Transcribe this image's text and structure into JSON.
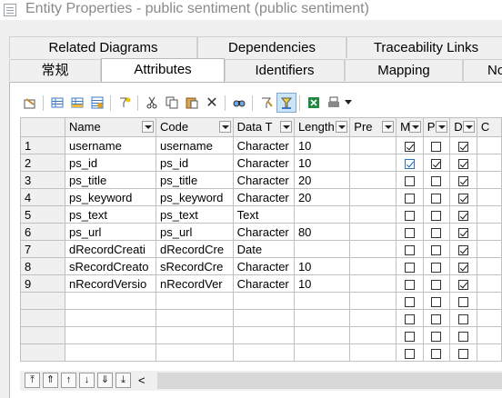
{
  "window": {
    "title": "Entity Properties - public sentiment (public sentiment)"
  },
  "tabs_row1": [
    "Related Diagrams",
    "Dependencies",
    "Traceability Links"
  ],
  "tabs_row2": [
    "常规",
    "Attributes",
    "Identifiers",
    "Mapping",
    "No"
  ],
  "active_tab": "Attributes",
  "grid": {
    "columns": [
      "Name",
      "Code",
      "Data T",
      "Length",
      "Pre",
      "M",
      "P",
      "D",
      "C"
    ],
    "rows": [
      {
        "n": "1",
        "name": "username",
        "code": "username",
        "type": "Character",
        "length": "10",
        "m": true,
        "p": false,
        "d": true
      },
      {
        "n": "2",
        "name": "ps_id",
        "code": "ps_id",
        "type": "Character",
        "length": "10",
        "m": true,
        "p": true,
        "d": true
      },
      {
        "n": "3",
        "name": "ps_title",
        "code": "ps_title",
        "type": "Character",
        "length": "20",
        "m": false,
        "p": false,
        "d": true
      },
      {
        "n": "4",
        "name": "ps_keyword",
        "code": "ps_keyword",
        "type": "Character",
        "length": "20",
        "m": false,
        "p": false,
        "d": true
      },
      {
        "n": "5",
        "name": "ps_text",
        "code": "ps_text",
        "type": "Text",
        "length": "",
        "m": false,
        "p": false,
        "d": true
      },
      {
        "n": "6",
        "name": "ps_url",
        "code": "ps_url",
        "type": "Character",
        "length": "80",
        "m": false,
        "p": false,
        "d": true
      },
      {
        "n": "7",
        "name": "dRecordCreati",
        "code": "dRecordCre",
        "type": "Date",
        "length": "",
        "m": false,
        "p": false,
        "d": true
      },
      {
        "n": "8",
        "name": "sRecordCreato",
        "code": "sRecordCre",
        "type": "Character",
        "length": "10",
        "m": false,
        "p": false,
        "d": true
      },
      {
        "n": "9",
        "name": "nRecordVersio",
        "code": "nRecordVer",
        "type": "Character",
        "length": "10",
        "m": false,
        "p": false,
        "d": true
      }
    ],
    "empty_rows": 4
  },
  "toolbar_icons": [
    "properties-icon",
    "insert-row-icon",
    "add-row-icon",
    "add-attributes-icon",
    "filter-icon",
    "cut-icon",
    "copy-icon",
    "paste-icon",
    "delete-icon",
    "find-icon",
    "customize-columns-icon",
    "filter-toggle-icon",
    "excel-export-icon",
    "print-icon",
    "dropdown-arrow-icon"
  ],
  "nav_icons": [
    "move-top-icon",
    "move-up-page-icon",
    "move-up-icon",
    "move-down-icon",
    "move-down-page-icon",
    "move-bottom-icon",
    "scroll-left-icon"
  ]
}
